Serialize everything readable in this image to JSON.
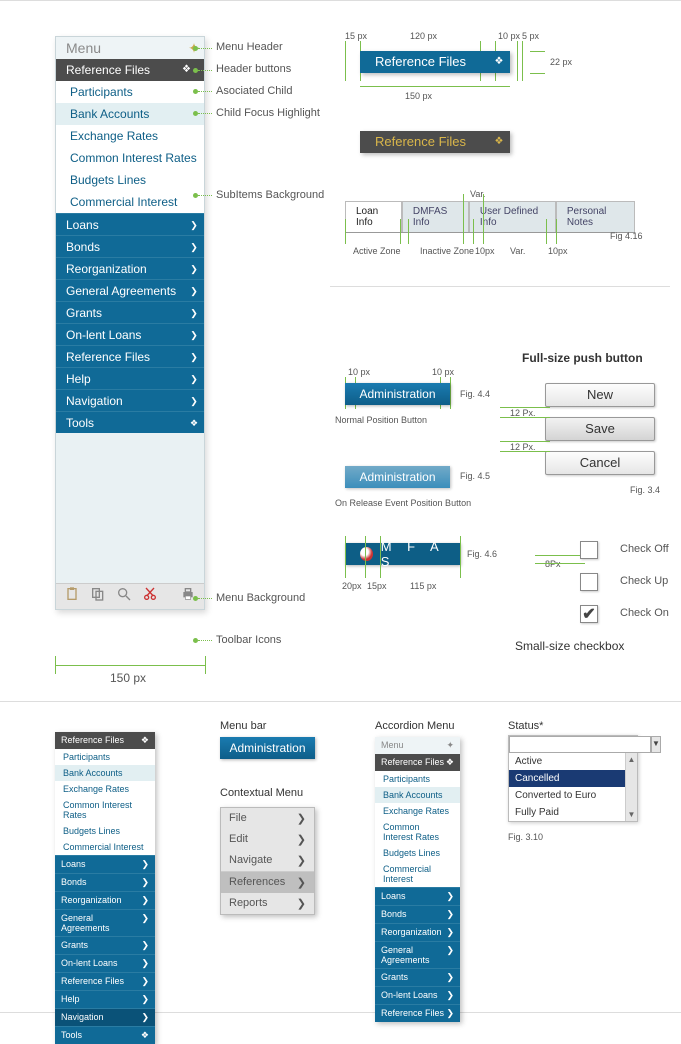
{
  "menu": {
    "title": "Menu",
    "selected": "Reference Files",
    "subs": [
      "Participants",
      "Bank Accounts",
      "Exchange Rates",
      "Common Interest Rates",
      "Budgets Lines",
      "Commercial Interest"
    ],
    "cats": [
      "Loans",
      "Bonds",
      "Reorganization",
      "General Agreements",
      "Grants",
      "On-lent Loans",
      "Reference Files",
      "Help",
      "Navigation",
      "Tools"
    ]
  },
  "annotations": {
    "a1": "Menu Header",
    "a2": "Header buttons",
    "a3": "Asociated Child",
    "a4": "Child Focus Highlight",
    "a5": "SubItems Background",
    "a6": "Menu Background",
    "a7": "Toolbar Icons",
    "width": "150 px"
  },
  "spec": {
    "px15": "15 px",
    "px120": "120 px",
    "px10": "10 px",
    "px5": "5 px",
    "px150": "150 px",
    "px22": "22 px",
    "ref": "Reference Files",
    "refgold": "Reference Files"
  },
  "tabs": {
    "t1": "Loan Info",
    "t2": "DMFAS Info",
    "t3": "User Defined Info",
    "t4": "Personal Notes",
    "fig": "Fig 4.16",
    "az": "Active Zone",
    "iz": "Inactive Zone",
    "ten": "10px",
    "var": "Var."
  },
  "pbtn": {
    "label": "Administration",
    "n": "Normal Position Button",
    "r": "On Release Event Position Button",
    "f44": "Fig. 4.4",
    "f45": "Fig. 4.5",
    "m10": "10 px"
  },
  "full": {
    "title": "Full-size push button",
    "b1": "New",
    "b2": "Save",
    "b3": "Cancel",
    "fig": "Fig. 3.4",
    "p12": "12 Px."
  },
  "dmfas": {
    "text": "M F A S",
    "fig": "Fig. 4.6",
    "p20": "20px",
    "p15": "15px",
    "pw": "115 px"
  },
  "check": {
    "title": "Small-size checkbox",
    "off": "Check Off",
    "up": "Check Up",
    "on": "Check On",
    "p8": "8Px"
  },
  "bottom": {
    "h_menubar": "Menu bar",
    "h_ctx": "Contextual Menu",
    "h_acc": "Accordion Menu",
    "h_status": "Status*",
    "fig": "Fig. 3.10",
    "ctx": [
      "File",
      "Edit",
      "Navigate",
      "References",
      "Reports"
    ],
    "status": [
      "Active",
      "Cancelled",
      "Converted to Euro",
      "Fully Paid"
    ]
  }
}
